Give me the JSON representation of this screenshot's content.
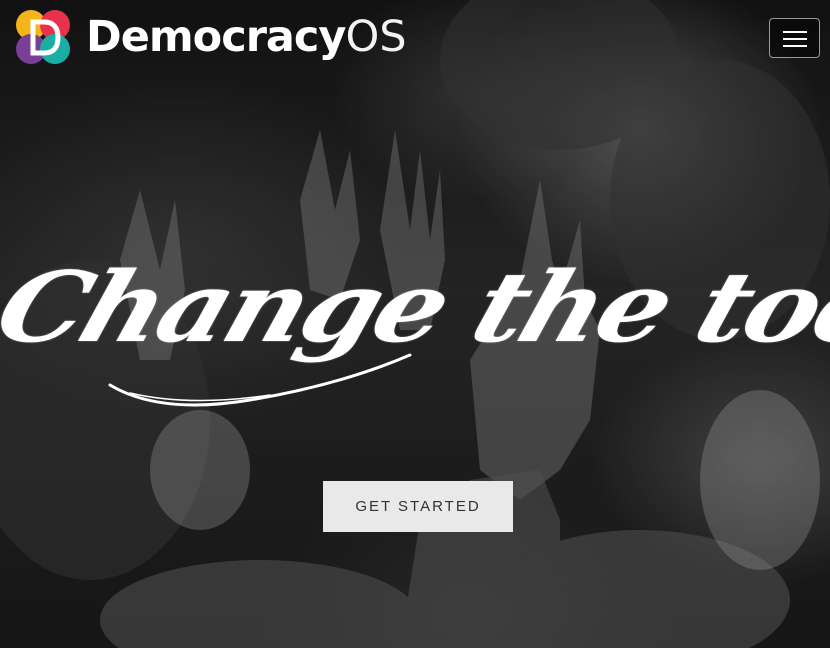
{
  "brand": {
    "name_bold": "Democracy",
    "name_light": "OS",
    "logo_icon": "democracyos-logo-icon",
    "logo_colors": [
      "#f4b41a",
      "#e8324b",
      "#7b3f98",
      "#1aaea5"
    ]
  },
  "nav": {
    "menu_icon": "hamburger-menu-icon"
  },
  "hero": {
    "headline": "Change the tool",
    "cta_label": "GET STARTED",
    "background": "black-and-white crowd with raised hands"
  },
  "colors": {
    "text": "#ffffff",
    "button_bg": "#e9e9e9",
    "button_text": "#333333"
  }
}
